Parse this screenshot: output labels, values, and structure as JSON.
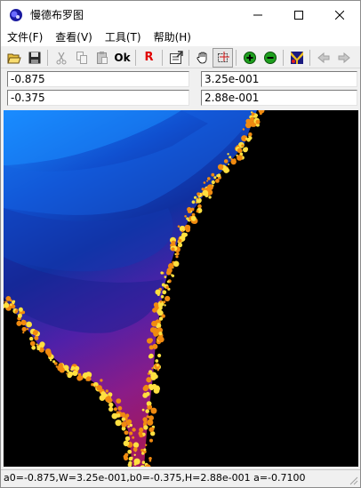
{
  "window": {
    "title": "慢德布罗图"
  },
  "menu": [
    {
      "label": "文件(F)"
    },
    {
      "label": "查看(V)"
    },
    {
      "label": "工具(T)"
    },
    {
      "label": "帮助(H)"
    }
  ],
  "toolbar": {
    "ok_label": "Ok",
    "r_label": "R",
    "icons": [
      "open-folder-icon",
      "save-icon",
      "cut-icon",
      "copy-icon",
      "paste-icon",
      "ok-icon",
      "reset-icon",
      "export-icon",
      "pan-hand-icon",
      "select-zoom-icon",
      "zoom-in-icon",
      "zoom-out-icon",
      "palette-icon",
      "back-arrow-icon",
      "forward-arrow-icon"
    ]
  },
  "params": {
    "a0": "-0.875",
    "w": "3.25e-001",
    "b0": "-0.375",
    "h": "2.88e-001"
  },
  "status": {
    "text": "a0=-0.875,W=3.25e-001,b0=-0.375,H=2.88e-001  a=-0.7100"
  },
  "colors": {
    "fractal_inner": "#000000",
    "band_outer": "#1a8cff",
    "band_mid": "#1030a0",
    "band_violet": "#6a1ea8",
    "band_magenta": "#9a1a78",
    "edge_orange": "#f08a10",
    "edge_yellow": "#ffe040"
  }
}
